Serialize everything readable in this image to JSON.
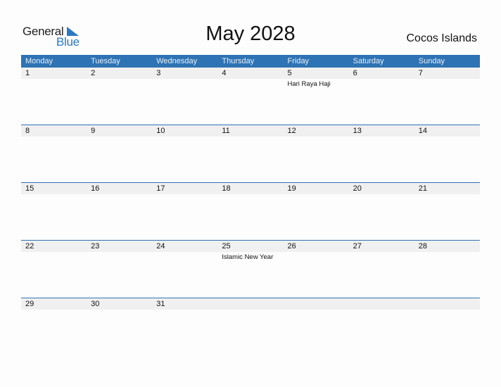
{
  "logo": {
    "word1": "General",
    "word2": "Blue",
    "icon": "triangle-flag-icon",
    "accent": "#2b78c2"
  },
  "title": "May 2028",
  "country": "Cocos Islands",
  "colors": {
    "header_bg": "#2e73b4",
    "date_strip_bg": "#f0f0f0"
  },
  "weekdays": [
    "Monday",
    "Tuesday",
    "Wednesday",
    "Thursday",
    "Friday",
    "Saturday",
    "Sunday"
  ],
  "weeks": [
    {
      "days": [
        "1",
        "2",
        "3",
        "4",
        "5",
        "6",
        "7"
      ],
      "events": [
        "",
        "",
        "",
        "",
        "Hari Raya Haji",
        "",
        ""
      ]
    },
    {
      "days": [
        "8",
        "9",
        "10",
        "11",
        "12",
        "13",
        "14"
      ],
      "events": [
        "",
        "",
        "",
        "",
        "",
        "",
        ""
      ]
    },
    {
      "days": [
        "15",
        "16",
        "17",
        "18",
        "19",
        "20",
        "21"
      ],
      "events": [
        "",
        "",
        "",
        "",
        "",
        "",
        ""
      ]
    },
    {
      "days": [
        "22",
        "23",
        "24",
        "25",
        "26",
        "27",
        "28"
      ],
      "events": [
        "",
        "",
        "",
        "Islamic New Year",
        "",
        "",
        ""
      ]
    },
    {
      "days": [
        "29",
        "30",
        "31",
        "",
        "",
        "",
        ""
      ],
      "events": [
        "",
        "",
        "",
        "",
        "",
        "",
        ""
      ]
    }
  ]
}
